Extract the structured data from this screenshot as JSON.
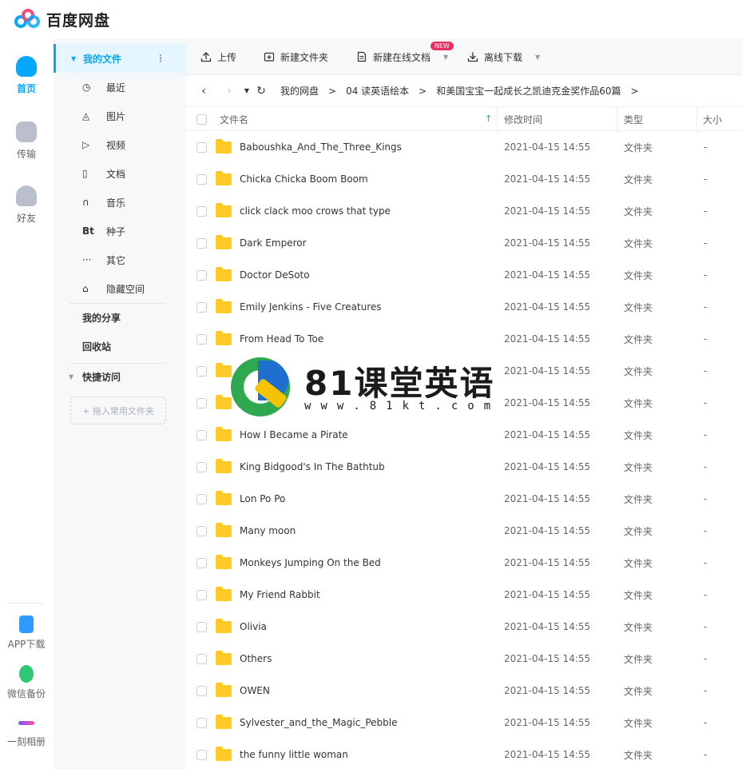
{
  "app": {
    "title": "百度网盘"
  },
  "rail": {
    "home": "首页",
    "transfer": "传输",
    "friends": "好友",
    "app_download": "APP下载",
    "wechat_backup": "微信备份",
    "moment_album": "一刻相册"
  },
  "sidebar": {
    "my_files": "我的文件",
    "items": [
      {
        "icon": "clock-icon",
        "glyph": "◷",
        "label": "最近"
      },
      {
        "icon": "image-icon",
        "glyph": "◬",
        "label": "图片"
      },
      {
        "icon": "video-icon",
        "glyph": "▷",
        "label": "视频"
      },
      {
        "icon": "document-icon",
        "glyph": "▯",
        "label": "文档"
      },
      {
        "icon": "headphone-icon",
        "glyph": "∩",
        "label": "音乐"
      },
      {
        "icon": "bt-icon",
        "glyph": "Bt",
        "label": "种子"
      },
      {
        "icon": "more-icon",
        "glyph": "···",
        "label": "其它"
      },
      {
        "icon": "lock-icon",
        "glyph": "⌂",
        "label": "隐藏空间"
      }
    ],
    "my_share": "我的分享",
    "recycle_bin": "回收站",
    "quick_access": "快捷访问",
    "drag_hint": "+ 拖入常用文件夹"
  },
  "toolbar": {
    "upload": "上传",
    "new_folder": "新建文件夹",
    "new_online_doc": "新建在线文档",
    "new_badge": "NEW",
    "offline_download": "离线下载"
  },
  "breadcrumb": {
    "root": "我的网盘",
    "level1": "04 读英语绘本",
    "level2": "和美国宝宝一起成长之凯迪克金奖作品60篇"
  },
  "table": {
    "headers": {
      "name": "文件名",
      "modified": "修改时间",
      "type": "类型",
      "size": "大小"
    },
    "rows": [
      {
        "name": "Baboushka_And_The_Three_Kings",
        "modified": "2021-04-15 14:55",
        "type": "文件夹",
        "size": "-"
      },
      {
        "name": "Chicka Chicka Boom Boom",
        "modified": "2021-04-15 14:55",
        "type": "文件夹",
        "size": "-"
      },
      {
        "name": "click clack moo crows that type",
        "modified": "2021-04-15 14:55",
        "type": "文件夹",
        "size": "-"
      },
      {
        "name": "Dark Emperor",
        "modified": "2021-04-15 14:55",
        "type": "文件夹",
        "size": "-"
      },
      {
        "name": "Doctor DeSoto",
        "modified": "2021-04-15 14:55",
        "type": "文件夹",
        "size": "-"
      },
      {
        "name": "Emily Jenkins - Five Creatures",
        "modified": "2021-04-15 14:55",
        "type": "文件夹",
        "size": "-"
      },
      {
        "name": "From Head To Toe",
        "modified": "2021-04-15 14:55",
        "type": "文件夹",
        "size": "-"
      },
      {
        "name": "",
        "modified": "2021-04-15 14:55",
        "type": "文件夹",
        "size": "-"
      },
      {
        "name": "",
        "modified": "2021-04-15 14:55",
        "type": "文件夹",
        "size": "-"
      },
      {
        "name": "How I Became a Pirate",
        "modified": "2021-04-15 14:55",
        "type": "文件夹",
        "size": "-"
      },
      {
        "name": "King Bidgood's In The Bathtub",
        "modified": "2021-04-15 14:55",
        "type": "文件夹",
        "size": "-"
      },
      {
        "name": "Lon Po Po",
        "modified": "2021-04-15 14:55",
        "type": "文件夹",
        "size": "-"
      },
      {
        "name": "Many moon",
        "modified": "2021-04-15 14:55",
        "type": "文件夹",
        "size": "-"
      },
      {
        "name": "Monkeys Jumping On the Bed",
        "modified": "2021-04-15 14:55",
        "type": "文件夹",
        "size": "-"
      },
      {
        "name": "My Friend Rabbit",
        "modified": "2021-04-15 14:55",
        "type": "文件夹",
        "size": "-"
      },
      {
        "name": "Olivia",
        "modified": "2021-04-15 14:55",
        "type": "文件夹",
        "size": "-"
      },
      {
        "name": "Others",
        "modified": "2021-04-15 14:55",
        "type": "文件夹",
        "size": "-"
      },
      {
        "name": "OWEN",
        "modified": "2021-04-15 14:55",
        "type": "文件夹",
        "size": "-"
      },
      {
        "name": "Sylvester_and_the_Magic_Pebble",
        "modified": "2021-04-15 14:55",
        "type": "文件夹",
        "size": "-"
      },
      {
        "name": "the funny little woman",
        "modified": "2021-04-15 14:55",
        "type": "文件夹",
        "size": "-"
      }
    ]
  },
  "watermark": {
    "brand": "81课堂英语",
    "url": "www.81kt.com"
  },
  "colors": {
    "accent": "#06a7ff",
    "badge": "#e83063",
    "folder": "#ffca28"
  }
}
